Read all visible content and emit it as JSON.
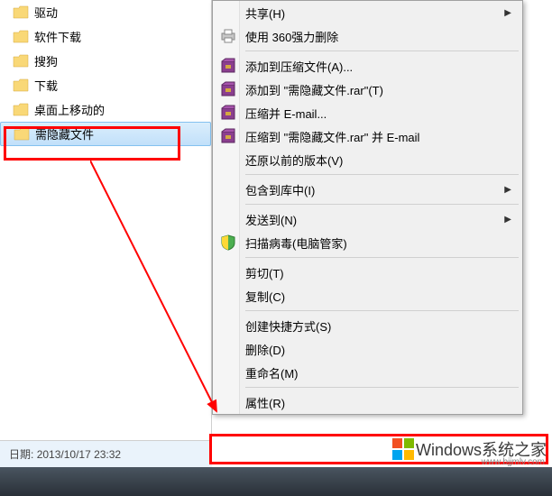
{
  "folders": [
    {
      "label": "驱动"
    },
    {
      "label": "软件下载"
    },
    {
      "label": "搜狗"
    },
    {
      "label": "下载"
    },
    {
      "label": "桌面上移动的"
    },
    {
      "label": "需隐藏文件",
      "selected": true
    }
  ],
  "status": {
    "date_label": "日期:",
    "date_value": "2013/10/17 23:32"
  },
  "menu": {
    "share": "共享(H)",
    "qihoo_delete": "使用 360强力删除",
    "rar_add": "添加到压缩文件(A)...",
    "rar_add_named": "添加到 \"需隐藏文件.rar\"(T)",
    "rar_email": "压缩并 E-mail...",
    "rar_email_named": "压缩到 \"需隐藏文件.rar\" 并 E-mail",
    "restore": "还原以前的版本(V)",
    "include_library": "包含到库中(I)",
    "send_to": "发送到(N)",
    "virus_scan": "扫描病毒(电脑管家)",
    "cut": "剪切(T)",
    "copy": "复制(C)",
    "create_shortcut": "创建快捷方式(S)",
    "delete": "删除(D)",
    "rename": "重命名(M)",
    "properties": "属性(R)"
  },
  "watermark": {
    "brand": "Windows系统之家",
    "url": "www.bjjmlv.com"
  }
}
